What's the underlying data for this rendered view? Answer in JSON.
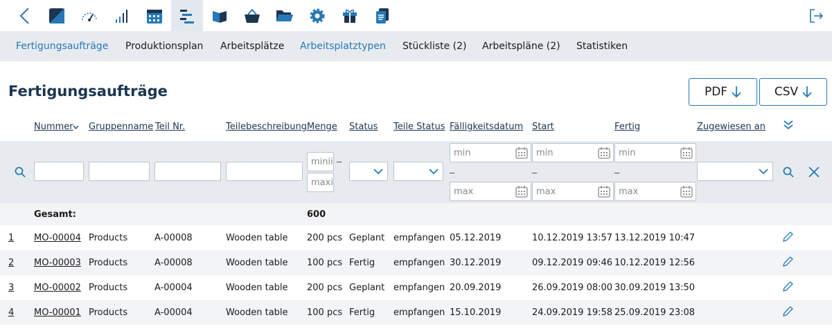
{
  "toolbar": {
    "icons": [
      "back-icon",
      "dashboard-icon",
      "speedometer-icon",
      "signal-bars-icon",
      "calendar-icon",
      "gantt-icon",
      "book-icon",
      "basket-icon",
      "folder-icon",
      "gear-icon",
      "gift-icon",
      "document-icon"
    ],
    "active": "gantt-icon"
  },
  "subnav": {
    "items": [
      "Fertigungsaufträge",
      "Produktionsplan",
      "Arbeitsplätze",
      "Arbeitsplatztypen",
      "Stückliste (2)",
      "Arbeitspläne (2)",
      "Statistiken"
    ]
  },
  "page": {
    "title": "Fertigungsaufträge",
    "pdf_label": "PDF",
    "csv_label": "CSV"
  },
  "table": {
    "headers": [
      "Nummer",
      "Gruppenname",
      "Teil Nr.",
      "Teilebeschreibung",
      "Menge",
      "Status",
      "Teile Status",
      "Fälligkeitsdatum",
      "Start",
      "Fertig",
      "Zugewiesen an"
    ],
    "filter": {
      "menge_min": "minii",
      "menge_max": "maxi",
      "date_min": "min",
      "date_max": "max",
      "range_dash": "–"
    },
    "total": {
      "label": "Gesamt:",
      "menge": "600"
    },
    "rows": [
      {
        "idx": "1",
        "nummer": "MO-00004",
        "gruppe": "Products",
        "teil": "A-00008",
        "beschreibung": "Wooden table",
        "menge": "200 pcs",
        "status": "Geplant",
        "teile_status": "empfangen",
        "faellig": "05.12.2019",
        "start": "10.12.2019 13:57",
        "fertig": "13.12.2019 10:47"
      },
      {
        "idx": "2",
        "nummer": "MO-00003",
        "gruppe": "Products",
        "teil": "A-00008",
        "beschreibung": "Wooden table",
        "menge": "100 pcs",
        "status": "Fertig",
        "teile_status": "empfangen",
        "faellig": "30.12.2019",
        "start": "09.12.2019 09:46",
        "fertig": "10.12.2019 12:56"
      },
      {
        "idx": "3",
        "nummer": "MO-00002",
        "gruppe": "Products",
        "teil": "A-00004",
        "beschreibung": "Wooden table",
        "menge": "200 pcs",
        "status": "Geplant",
        "teile_status": "empfangen",
        "faellig": "20.09.2019",
        "start": "26.09.2019 08:00",
        "fertig": "30.09.2019 13:50"
      },
      {
        "idx": "4",
        "nummer": "MO-00001",
        "gruppe": "Products",
        "teil": "A-00004",
        "beschreibung": "Wooden table",
        "menge": "100 pcs",
        "status": "Fertig",
        "teile_status": "empfangen",
        "faellig": "15.10.2019",
        "start": "24.09.2019 19:58",
        "fertig": "25.09.2019 23:08"
      }
    ]
  },
  "colors": {
    "accent": "#2678b6",
    "title": "#1c3550",
    "band": "#e7ebef"
  }
}
